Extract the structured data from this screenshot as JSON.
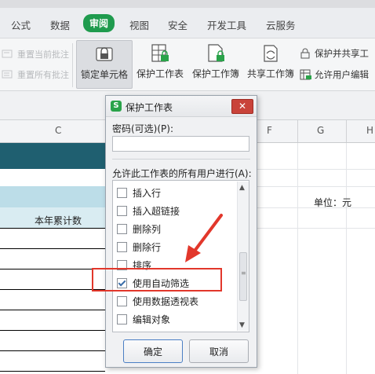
{
  "ribbon": {
    "tabs": [
      {
        "label": "公式"
      },
      {
        "label": "数据"
      },
      {
        "label": "审阅",
        "active": true
      },
      {
        "label": "视图"
      },
      {
        "label": "安全"
      },
      {
        "label": "开发工具"
      },
      {
        "label": "云服务"
      }
    ],
    "left_commands": [
      {
        "label": "重置当前批注",
        "enabled": false
      },
      {
        "label": "重置所有批注",
        "enabled": false
      }
    ],
    "big_buttons": [
      {
        "label": "锁定单元格",
        "selected": true
      },
      {
        "label": "保护工作表"
      },
      {
        "label": "保护工作簿"
      },
      {
        "label": "共享工作簿"
      }
    ],
    "right_commands": [
      {
        "label": "保护并共享工"
      },
      {
        "label": "允许用户编辑"
      }
    ],
    "accent_color": "#1f9b4e"
  },
  "sheet": {
    "column_headers": [
      "C",
      "F",
      "G",
      "H"
    ],
    "label_cell": "本年累计数",
    "unit_text": "单位：元"
  },
  "dialog": {
    "title": "保护工作表",
    "close_label": "✕",
    "password_label": "密码(可选)(P):",
    "password_value": "",
    "allow_label": "允许此工作表的所有用户进行(A):",
    "permissions": [
      {
        "label": "插入行",
        "checked": false
      },
      {
        "label": "插入超链接",
        "checked": false
      },
      {
        "label": "删除列",
        "checked": false
      },
      {
        "label": "删除行",
        "checked": false
      },
      {
        "label": "排序",
        "checked": false
      },
      {
        "label": "使用自动筛选",
        "checked": true
      },
      {
        "label": "使用数据透视表",
        "checked": false
      },
      {
        "label": "编辑对象",
        "checked": false
      }
    ],
    "ok_label": "确定",
    "cancel_label": "取消"
  },
  "annotation": {
    "highlight_color": "#e2372b"
  }
}
